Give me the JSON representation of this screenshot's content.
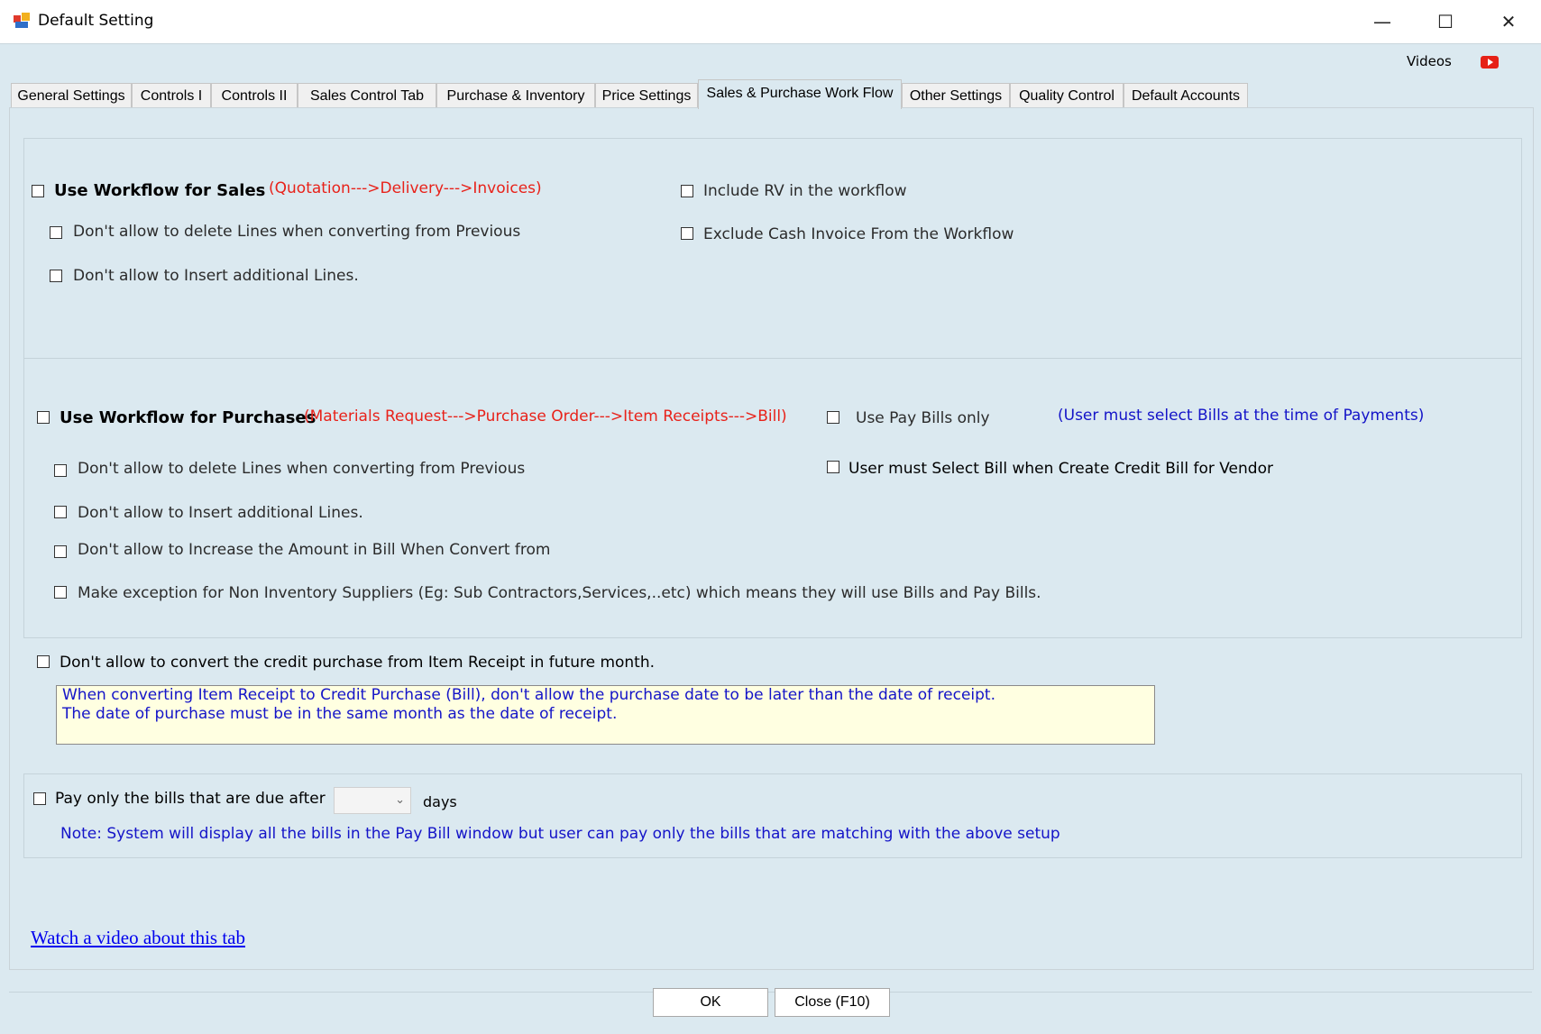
{
  "window": {
    "title": "Default Setting",
    "icon": "app-icon",
    "controls": {
      "minimize": "—",
      "maximize": "☐",
      "close": "✕"
    }
  },
  "header": {
    "videos_label": "Videos",
    "youtube_icon": "youtube-icon"
  },
  "tabs": [
    {
      "label": "General Settings"
    },
    {
      "label": "Controls I"
    },
    {
      "label": "Controls II"
    },
    {
      "label": "Sales Control Tab"
    },
    {
      "label": "Purchase & Inventory"
    },
    {
      "label": "Price Settings"
    },
    {
      "label": "Sales & Purchase Work Flow",
      "active": true
    },
    {
      "label": "Other Settings"
    },
    {
      "label": "Quality Control"
    },
    {
      "label": "Default Accounts"
    }
  ],
  "sales": {
    "use_workflow_label": "Use Workflow for Sales",
    "flow_text": "(Quotation--->Delivery--->Invoices)",
    "no_delete_lines": "Don't allow to delete Lines when converting from Previous",
    "no_insert_lines": "Don't allow to Insert additional Lines.",
    "include_rv": "Include RV in the workflow",
    "exclude_cash_invoice": "Exclude Cash Invoice From the Workflow"
  },
  "purchases": {
    "use_workflow_label": "Use Workflow for Purchases",
    "flow_text": "(Materials Request--->Purchase Order--->Item Receipts--->Bill)",
    "use_pay_bills_only": "Use Pay Bills only",
    "pay_bills_note": "(User must select Bills at the time of Payments)",
    "no_delete_lines": "Don't allow to delete Lines when converting from Previous",
    "select_bill_credit": "User must Select Bill when Create Credit Bill for Vendor",
    "no_insert_lines": "Don't allow to Insert additional Lines.",
    "no_increase_amount": "Don't allow to Increase the Amount in Bill When Convert from",
    "non_inventory_exception": "Make exception for Non Inventory Suppliers (Eg: Sub Contractors,Services,..etc) which means they will use Bills and Pay Bills."
  },
  "credit_purchase": {
    "label": "Don't allow to convert the credit purchase from Item Receipt in future month.",
    "note_line1": "When converting Item Receipt to Credit Purchase (Bill), don't allow the purchase date to be later than the date of receipt.",
    "note_line2": "The date of purchase must be in the same month as the date of receipt."
  },
  "pay_bills": {
    "label": "Pay only the bills that are due after",
    "days_value": "",
    "days_label": "days",
    "note": "Note: System will display all the bills in the Pay Bill window but user can pay only the bills that are matching with the above setup"
  },
  "video_link": "Watch a video about this tab",
  "buttons": {
    "ok": "OK",
    "close": "Close (F10)"
  },
  "colors": {
    "panel_bg": "#dbe9f0",
    "flow_red": "#e8221a",
    "note_blue": "#1414c8",
    "note_bg": "#ffffe1"
  }
}
